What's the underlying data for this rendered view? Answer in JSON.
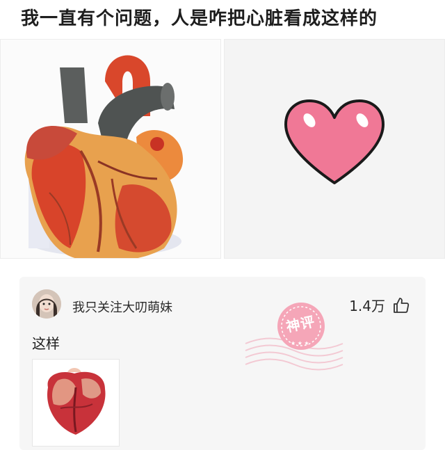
{
  "post": {
    "title": "我一直有个问题，人是咋把心脏看成这样的"
  },
  "images": {
    "left": {
      "icon": "anatomical-heart-model"
    },
    "right": {
      "icon": "cartoon-heart"
    }
  },
  "comment": {
    "username": "我只关注大叨萌妹",
    "like_count": "1.4万",
    "text": "这样",
    "badge": "神评",
    "thumb_icon": "real-heart-photo"
  },
  "colors": {
    "cartoon_heart_fill": "#f07896",
    "badge_pink": "#f5a6b8",
    "anatomical_red": "#d8442a",
    "anatomical_orange": "#e9974a"
  }
}
